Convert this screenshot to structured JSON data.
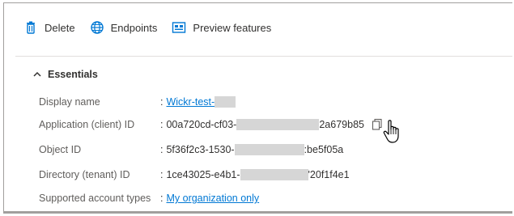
{
  "toolbar": {
    "delete_label": "Delete",
    "endpoints_label": "Endpoints",
    "preview_label": "Preview features"
  },
  "essentials": {
    "title": "Essentials"
  },
  "fields": [
    {
      "label": "Display name",
      "value": "Wickr-test-",
      "value_tail": "",
      "link": true
    },
    {
      "label": "Application (client) ID",
      "value": "00a720cd-cf03-",
      "value_tail": "2a679b85",
      "link": false
    },
    {
      "label": "Object ID",
      "value": "5f36f2c3-1530-",
      "value_tail": ":be5f05a",
      "link": false
    },
    {
      "label": "Directory (tenant) ID",
      "value": "1ce43025-e4b1-",
      "value_tail": "'20f1f4e1",
      "link": false
    },
    {
      "label": "Supported account types",
      "value": "My organization only",
      "value_tail": "",
      "link": true
    }
  ],
  "colon": ":",
  "colors": {
    "accent": "#0078d4",
    "text": "#323130",
    "label": "#605e5c",
    "redaction": "#d6d6d6"
  }
}
